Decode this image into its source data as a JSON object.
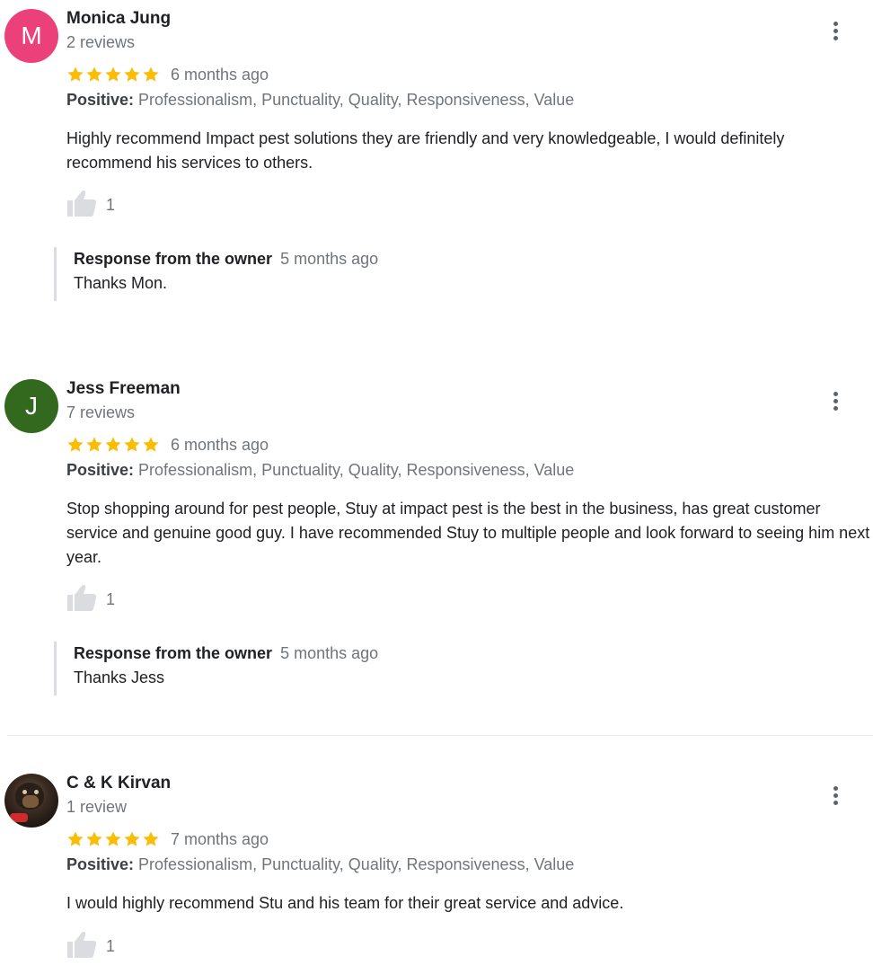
{
  "reviews": [
    {
      "avatar_letter": "M",
      "avatar_color": "#ec407a",
      "name": "Monica Jung",
      "review_count": "2 reviews",
      "stars": 5,
      "time": "6 months ago",
      "positive_label": "Positive:",
      "positive_text": "Professionalism, Punctuality, Quality, Responsiveness, Value",
      "text": "Highly recommend Impact pest solutions they are friendly and very knowledgeable, I would definitely recommend his services to others.",
      "likes": "1",
      "response": {
        "title": "Response from the owner",
        "time": "5 months ago",
        "text": "Thanks Mon."
      }
    },
    {
      "avatar_letter": "J",
      "avatar_color": "#33691e",
      "name": "Jess Freeman",
      "review_count": "7 reviews",
      "stars": 5,
      "time": "6 months ago",
      "positive_label": "Positive:",
      "positive_text": "Professionalism, Punctuality, Quality, Responsiveness, Value",
      "text": "Stop shopping around for pest people, Stuy at impact pest is the best in the business, has great customer service and genuine good guy. I have recommended Stuy to multiple people and look forward to seeing him next year.",
      "likes": "1",
      "response": {
        "title": "Response from the owner",
        "time": "5 months ago",
        "text": "Thanks Jess"
      }
    },
    {
      "avatar_letter": "",
      "avatar_color": "",
      "name": "C & K Kirvan",
      "review_count": "1 review",
      "stars": 5,
      "time": "7 months ago",
      "positive_label": "Positive:",
      "positive_text": "Professionalism, Punctuality, Quality, Responsiveness, Value",
      "text": "I would highly recommend Stu and his team for their great service and advice.",
      "likes": "1"
    }
  ],
  "colors": {
    "star": "#fbbc04",
    "muted": "#70757a",
    "divider": "#ebebeb"
  },
  "icons": {
    "star": "star-icon",
    "like": "thumbs-up-icon",
    "more": "more-vert-icon"
  }
}
